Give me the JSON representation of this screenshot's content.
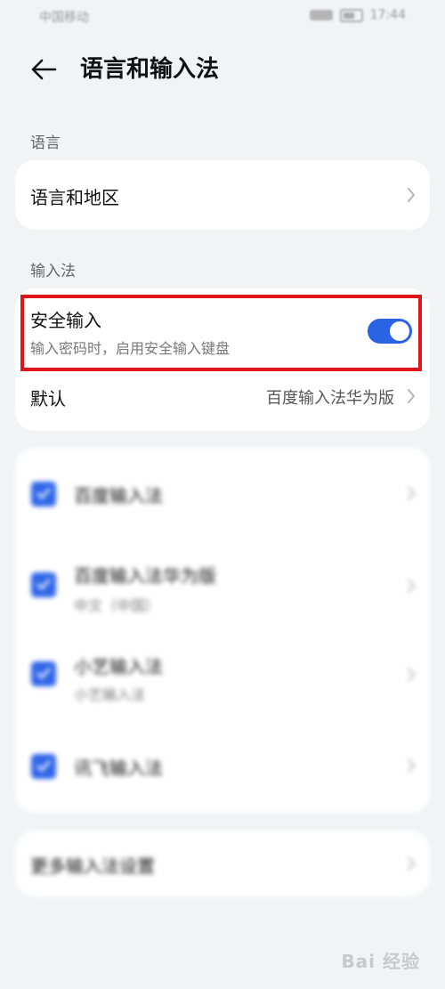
{
  "status_bar": {
    "carrier": "中国移动",
    "time": "17:44"
  },
  "header": {
    "back_icon": "arrow-left-icon",
    "title": "语言和输入法"
  },
  "section_language": {
    "label": "语言",
    "item": "语言和地区"
  },
  "section_input": {
    "label": "输入法",
    "secure_input": {
      "title": "安全输入",
      "subtitle": "输入密码时，启用安全输入键盘",
      "enabled": true
    },
    "default": {
      "title": "默认",
      "value": "百度输入法华为版"
    }
  },
  "input_methods": [
    {
      "name": "百度输入法",
      "sub": "",
      "checked": true
    },
    {
      "name": "百度输入法华为版",
      "sub": "中文（中国）",
      "checked": true
    },
    {
      "name": "小艺输入法",
      "sub": "小艺输入法",
      "checked": true
    },
    {
      "name": "讯飞输入法",
      "sub": "",
      "checked": true
    }
  ],
  "more_settings": "更多输入法设置",
  "watermark": "Bai 经验",
  "colors": {
    "accent": "#2a63e4",
    "highlight": "#e0161b",
    "background": "#f1f3f5"
  }
}
